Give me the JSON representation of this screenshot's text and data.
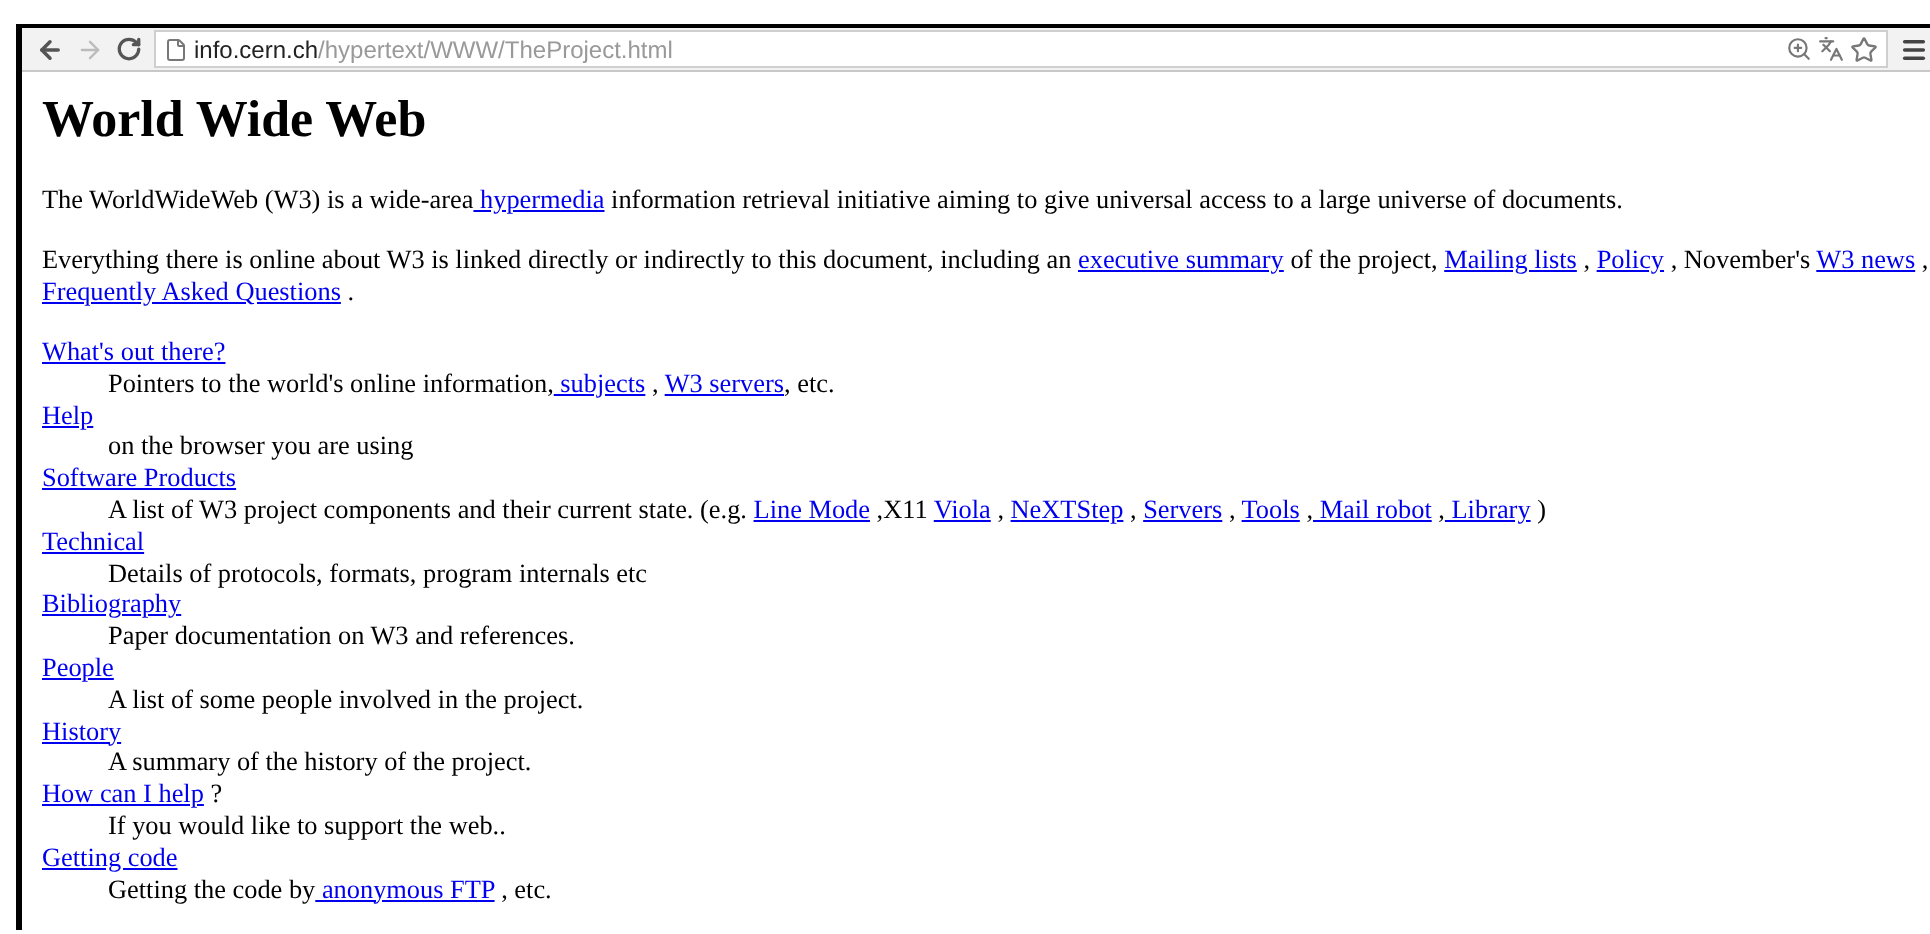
{
  "browser": {
    "url_host": "info.cern.ch",
    "url_path": "/hypertext/WWW/TheProject.html",
    "back_disabled": false,
    "forward_disabled": true
  },
  "page": {
    "title": "World Wide Web",
    "paragraphs": [
      {
        "lines": [
          [
            {
              "text": "The WorldWideWeb (W3) is a wide-area",
              "kind": "text"
            },
            {
              "text": " hypermedia",
              "kind": "link"
            },
            {
              "text": " information retrieval initiative aiming to give universal access to a large universe of documents.",
              "kind": "text"
            }
          ]
        ]
      },
      {
        "lines": [
          [
            {
              "text": "Everything there is online about W3 is linked directly or indirectly to this document, including an ",
              "kind": "text"
            },
            {
              "text": "executive summary",
              "kind": "link"
            },
            {
              "text": " of the project, ",
              "kind": "text"
            },
            {
              "text": "Mailing lists",
              "kind": "link"
            },
            {
              "text": " , ",
              "kind": "text"
            },
            {
              "text": "Policy",
              "kind": "link"
            },
            {
              "text": " , November's ",
              "kind": "text"
            },
            {
              "text": "W3 news",
              "kind": "link"
            },
            {
              "text": " ,",
              "kind": "text"
            }
          ],
          [
            {
              "text": "Frequently Asked Questions",
              "kind": "link"
            },
            {
              "text": " .",
              "kind": "text"
            }
          ]
        ]
      }
    ],
    "entries": [
      {
        "term": [
          {
            "text": "What's out there?",
            "kind": "link"
          }
        ],
        "description": [
          {
            "text": "Pointers to the world's online information,",
            "kind": "text"
          },
          {
            "text": " subjects",
            "kind": "link"
          },
          {
            "text": " , ",
            "kind": "text"
          },
          {
            "text": "W3 servers",
            "kind": "link"
          },
          {
            "text": ", etc.",
            "kind": "text"
          }
        ]
      },
      {
        "term": [
          {
            "text": "Help",
            "kind": "link"
          }
        ],
        "description": [
          {
            "text": "on the browser you are using",
            "kind": "text"
          }
        ]
      },
      {
        "term": [
          {
            "text": "Software Products",
            "kind": "link"
          }
        ],
        "description": [
          {
            "text": "A list of W3 project components and their current state. (e.g. ",
            "kind": "text"
          },
          {
            "text": "Line Mode",
            "kind": "link"
          },
          {
            "text": " ,X11 ",
            "kind": "text"
          },
          {
            "text": "Viola",
            "kind": "link"
          },
          {
            "text": " , ",
            "kind": "text"
          },
          {
            "text": "NeXTStep",
            "kind": "link"
          },
          {
            "text": " , ",
            "kind": "text"
          },
          {
            "text": "Servers",
            "kind": "link"
          },
          {
            "text": " , ",
            "kind": "text"
          },
          {
            "text": "Tools",
            "kind": "link"
          },
          {
            "text": " ,",
            "kind": "text"
          },
          {
            "text": " Mail robot",
            "kind": "link"
          },
          {
            "text": " ,",
            "kind": "text"
          },
          {
            "text": " Library",
            "kind": "link"
          },
          {
            "text": " )",
            "kind": "text"
          }
        ]
      },
      {
        "term": [
          {
            "text": "Technical",
            "kind": "link"
          }
        ],
        "description": [
          {
            "text": "Details of protocols, formats, program internals etc",
            "kind": "text"
          }
        ]
      },
      {
        "term": [
          {
            "text": "Bibliography",
            "kind": "link"
          }
        ],
        "description": [
          {
            "text": "Paper documentation on W3 and references.",
            "kind": "text"
          }
        ]
      },
      {
        "term": [
          {
            "text": "People",
            "kind": "link"
          }
        ],
        "description": [
          {
            "text": "A list of some people involved in the project.",
            "kind": "text"
          }
        ]
      },
      {
        "term": [
          {
            "text": "History",
            "kind": "link"
          }
        ],
        "description": [
          {
            "text": "A summary of the history of the project.",
            "kind": "text"
          }
        ]
      },
      {
        "term": [
          {
            "text": "How can I help",
            "kind": "link"
          },
          {
            "text": " ?",
            "kind": "text"
          }
        ],
        "description": [
          {
            "text": "If you would like to support the web..",
            "kind": "text"
          }
        ]
      },
      {
        "term": [
          {
            "text": "Getting code",
            "kind": "link"
          }
        ],
        "description": [
          {
            "text": "Getting the code by",
            "kind": "text"
          },
          {
            "text": " anonymous FTP",
            "kind": "link"
          },
          {
            "text": " , etc.",
            "kind": "text"
          }
        ]
      }
    ]
  }
}
